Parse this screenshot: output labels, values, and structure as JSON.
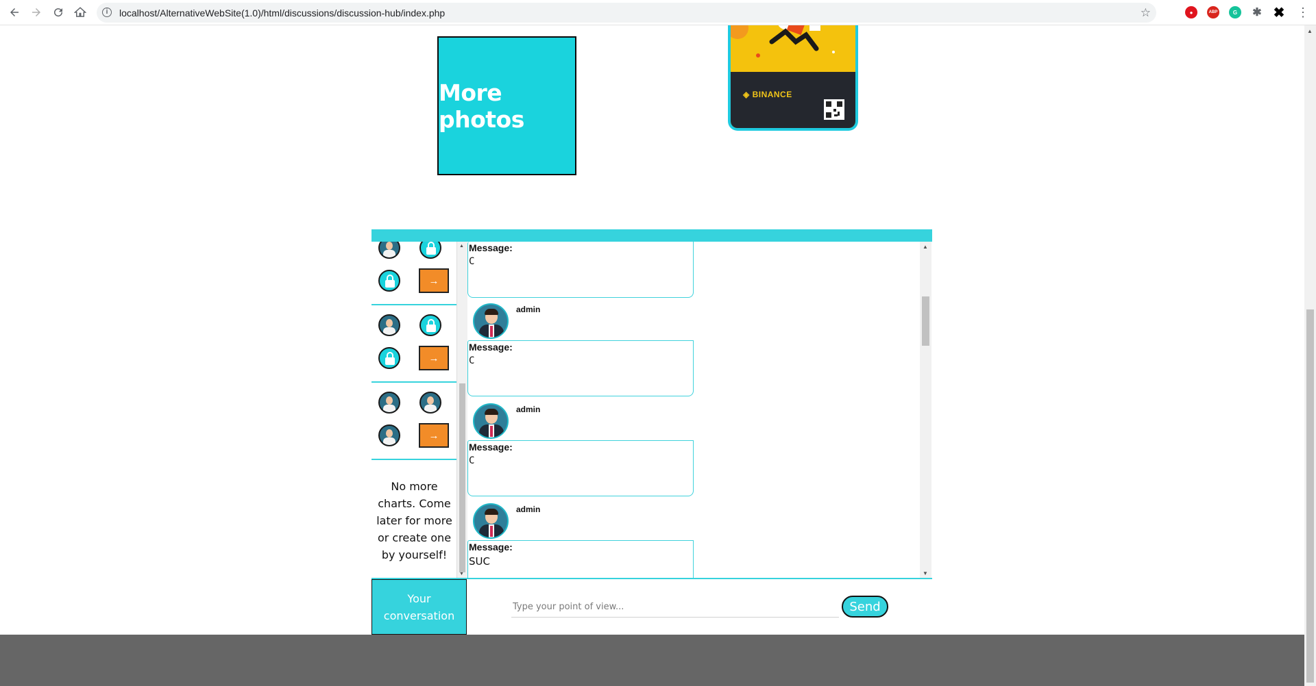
{
  "browser": {
    "url": "localhost/AlternativeWebSite(1.0)/html/discussions/discussion-hub/index.php"
  },
  "photos": {
    "label": "More photos"
  },
  "ad": {
    "brand": "BINANCE"
  },
  "chart_list": {
    "arrow_label": "→",
    "empty_text": "No more charts. Come later for more or create one by yourself!"
  },
  "messages": [
    {
      "author": "",
      "label": "Message:",
      "text": "C"
    },
    {
      "author": "admin",
      "label": "Message:",
      "text": "C"
    },
    {
      "author": "admin",
      "label": "Message:",
      "text": "C"
    },
    {
      "author": "admin",
      "label": "Message:",
      "text": "SUC"
    }
  ],
  "composer": {
    "conversation_label": "Your conversation",
    "placeholder": "Type your point of view...",
    "send_label": "Send"
  },
  "colors": {
    "accent": "#36d3dd",
    "arrow_button": "#f28c28",
    "footer": "#666666"
  }
}
